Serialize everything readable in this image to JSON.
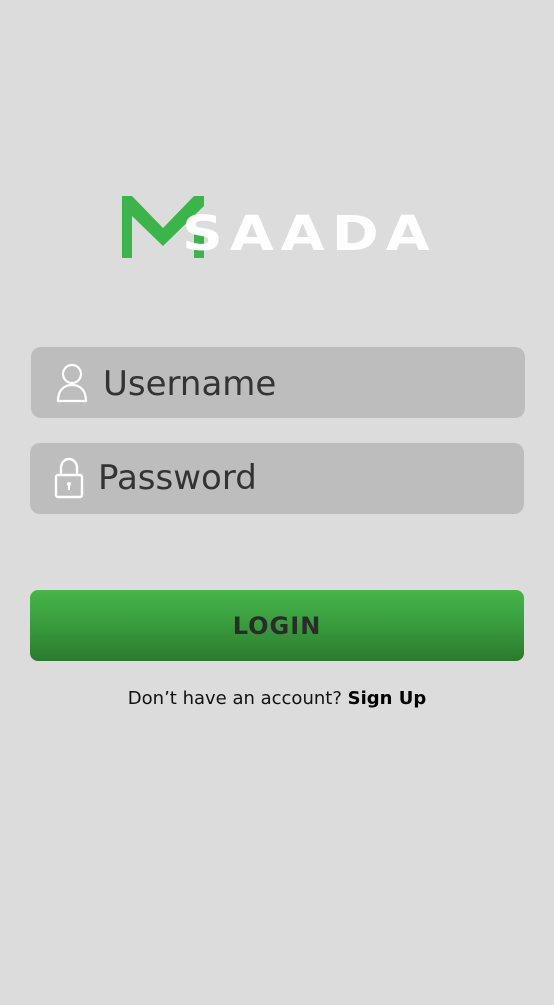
{
  "logo": {
    "text": "SAADA",
    "accent_color": "#3bb54a"
  },
  "login_form": {
    "username_placeholder": "Username",
    "password_placeholder": "Password",
    "login_label": "LOGIN"
  },
  "signup": {
    "prompt": "Don’t have an account? ",
    "link_label": "Sign Up"
  },
  "icons": {
    "username": "user-icon",
    "password": "lock-icon"
  },
  "colors": {
    "background": "#dcdcdc",
    "field_background": "#bdbdbd",
    "button_top": "#45b649",
    "button_bottom": "#2b7a2e"
  }
}
